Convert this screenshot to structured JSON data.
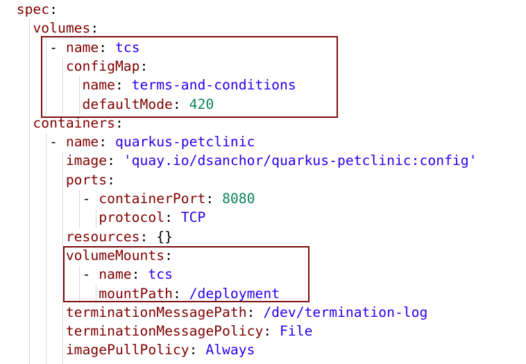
{
  "colors": {
    "key": "#800000",
    "string": "#2200ee",
    "number": "#098658",
    "highlight_border": "#7a0a0a",
    "indent_guide": "#d8d8d8"
  },
  "lines": [
    {
      "indent": 0,
      "dash": "",
      "key": "spec",
      "sep": ":",
      "value": "",
      "type": ""
    },
    {
      "indent": 1,
      "dash": "",
      "key": "volumes",
      "sep": ":",
      "value": "",
      "type": ""
    },
    {
      "indent": 2,
      "dash": "- ",
      "key": "name",
      "sep": ": ",
      "value": "tcs",
      "type": "s"
    },
    {
      "indent": 3,
      "dash": "",
      "key": "configMap",
      "sep": ":",
      "value": "",
      "type": ""
    },
    {
      "indent": 4,
      "dash": "",
      "key": "name",
      "sep": ": ",
      "value": "terms-and-conditions",
      "type": "s"
    },
    {
      "indent": 4,
      "dash": "",
      "key": "defaultMode",
      "sep": ": ",
      "value": "420",
      "type": "n"
    },
    {
      "indent": 1,
      "dash": "",
      "key": "containers",
      "sep": ":",
      "value": "",
      "type": ""
    },
    {
      "indent": 2,
      "dash": "- ",
      "key": "name",
      "sep": ": ",
      "value": "quarkus-petclinic",
      "type": "s"
    },
    {
      "indent": 3,
      "dash": "",
      "key": "image",
      "sep": ": ",
      "value": "'quay.io/dsanchor/quarkus-petclinic:config'",
      "type": "s"
    },
    {
      "indent": 3,
      "dash": "",
      "key": "ports",
      "sep": ":",
      "value": "",
      "type": ""
    },
    {
      "indent": 4,
      "dash": "- ",
      "key": "containerPort",
      "sep": ": ",
      "value": "8080",
      "type": "n"
    },
    {
      "indent": 5,
      "dash": "",
      "key": "protocol",
      "sep": ": ",
      "value": "TCP",
      "type": "s"
    },
    {
      "indent": 3,
      "dash": "",
      "key": "resources",
      "sep": ": ",
      "value": "{}",
      "type": "p"
    },
    {
      "indent": 3,
      "dash": "",
      "key": "volumeMounts",
      "sep": ":",
      "value": "",
      "type": ""
    },
    {
      "indent": 4,
      "dash": "- ",
      "key": "name",
      "sep": ": ",
      "value": "tcs",
      "type": "s"
    },
    {
      "indent": 5,
      "dash": "",
      "key": "mountPath",
      "sep": ": ",
      "value": "/deployment",
      "type": "s"
    },
    {
      "indent": 3,
      "dash": "",
      "key": "terminationMessagePath",
      "sep": ": ",
      "value": "/dev/termination-log",
      "type": "s"
    },
    {
      "indent": 3,
      "dash": "",
      "key": "terminationMessagePolicy",
      "sep": ": ",
      "value": "File",
      "type": "s"
    },
    {
      "indent": 3,
      "dash": "",
      "key": "imagePullPolicy",
      "sep": ": ",
      "value": "Always",
      "type": "s"
    }
  ]
}
